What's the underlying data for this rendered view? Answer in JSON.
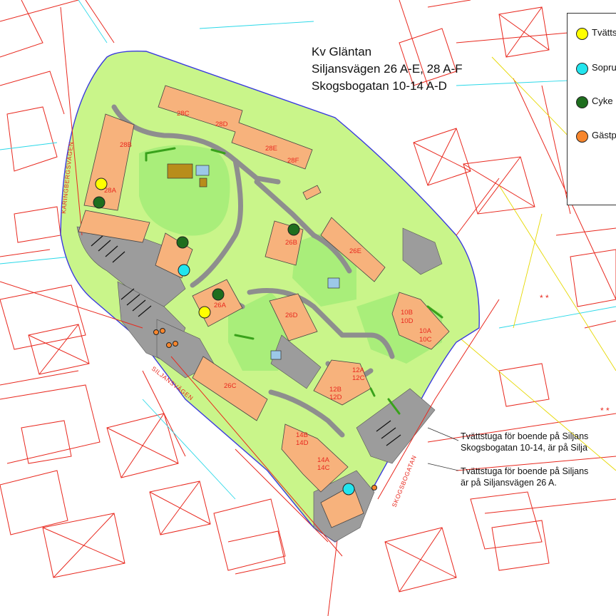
{
  "title": {
    "line1": "Kv Gläntan",
    "line2": "Siljansvägen 26 A-E, 28 A-F",
    "line3": "Skogsbogatan 10-14 A-D"
  },
  "legend": {
    "items": [
      {
        "label": "Tvätts",
        "color": "#ffff00",
        "icon": "laundry-dot-icon"
      },
      {
        "label": "Sopru",
        "color": "#22e5ee",
        "icon": "waste-room-dot-icon"
      },
      {
        "label": "Cyke",
        "color": "#1e6e1e",
        "icon": "bicycle-dot-icon"
      },
      {
        "label": "Gästp",
        "color": "#f7862d",
        "icon": "guest-parking-dot-icon"
      }
    ]
  },
  "notes": {
    "note1_line1": "Tvättstuga för boende på Siljans",
    "note1_line2": "Skogsbogatan 10-14, är på Silja",
    "note2_line1": "Tvättstuga för boende på Siljans",
    "note2_line2": "är på Siljansvägen 26 A."
  },
  "street_labels": {
    "karingbergsvagen": "KARINGBERGSVÄGEN",
    "siljansvagen": "SILJANSVÄGEN",
    "skogsbogatan": "SKOGSBOGATAN"
  },
  "building_labels": {
    "b28A": "28A",
    "b28B": "28B",
    "b28C": "28C",
    "b28D": "28D",
    "b28E": "28E",
    "b28F": "28F",
    "b26A": "26A",
    "b26B": "26B",
    "b26C": "26C",
    "b26D": "26D",
    "b26E": "26E",
    "b10B": "10B",
    "b10D": "10D",
    "b10A": "10A",
    "b10C": "10C",
    "b12A": "12A",
    "b12C": "12C",
    "b12B": "12B",
    "b12D": "12D",
    "b14B": "14B",
    "b14D": "14D",
    "b14A": "14A",
    "b14C": "14C"
  },
  "colors": {
    "grass": "#c9f58a",
    "lawn": "#a9ee7a",
    "building": "#f7b27c",
    "asphalt": "#9c9c9c",
    "cadastral_line": "#e8281e",
    "boundary": "#3a3adf",
    "laundry": "#ffff00",
    "waste": "#22e5ee",
    "bicycle": "#1e6e1e",
    "guest_parking": "#f7862d"
  }
}
